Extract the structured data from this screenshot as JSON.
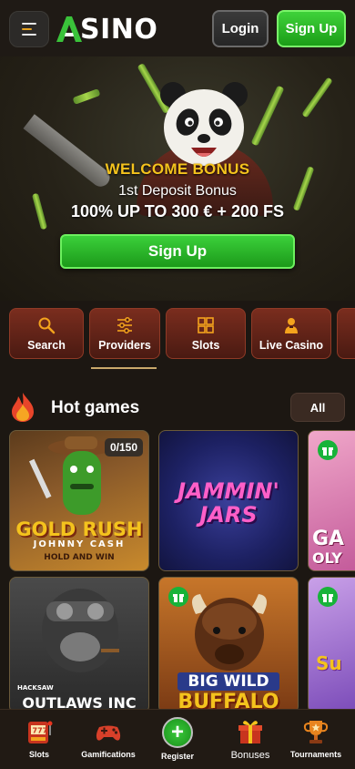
{
  "header": {
    "logo_text": "SINO",
    "login_label": "Login",
    "signup_label": "Sign Up"
  },
  "hero": {
    "welcome": "WELCOME BONUS",
    "deposit": "1st Deposit Bonus",
    "offer": "100% UP TO 300 € + 200 FS",
    "cta": "Sign Up"
  },
  "categories": [
    {
      "label": "Search",
      "icon": "search-icon"
    },
    {
      "label": "Providers",
      "icon": "sliders-icon"
    },
    {
      "label": "Slots",
      "icon": "grid-icon"
    },
    {
      "label": "Live Casino",
      "icon": "dealer-icon"
    }
  ],
  "hot_games": {
    "title": "Hot games",
    "all_label": "All",
    "games": [
      {
        "title_main": "GOLD RUSH",
        "title_sub": "JOHNNY CASH",
        "title_tag": "HOLD AND WIN",
        "badge": "0/150"
      },
      {
        "title_main": "JAMMIN'",
        "title_sub": "JARS"
      },
      {
        "title_main": "GA",
        "title_sub": "OLY"
      },
      {
        "title_main": "OUTLAWS INC",
        "title_tag": "HACKSAW"
      },
      {
        "title_main": "BIG WILD",
        "title_sub": "BUFFALO"
      },
      {
        "title_main": "Su"
      }
    ]
  },
  "bottom_nav": [
    {
      "label": "Slots",
      "icon": "slot-machine-icon"
    },
    {
      "label": "Gamifications",
      "icon": "gamepad-icon"
    },
    {
      "label": "Register",
      "icon": "plus-icon"
    },
    {
      "label": "Bonuses",
      "icon": "gift-icon"
    },
    {
      "label": "Tournaments",
      "icon": "trophy-icon"
    }
  ],
  "colors": {
    "accent_green": "#2bbd2a",
    "bonus_gold": "#f4c31d",
    "category_red": "#6a2619"
  }
}
